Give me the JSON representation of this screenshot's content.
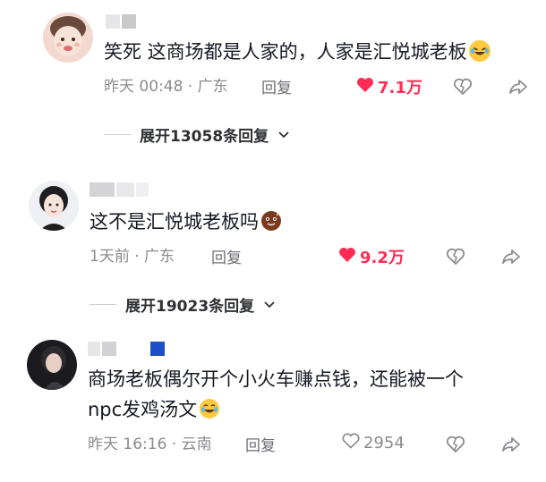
{
  "comments": [
    {
      "text": "笑死 这商场都是人家的，人家是汇悦城老板",
      "emoji": "rofl-emoji",
      "time_location": "昨天 00:48 · 广东",
      "reply_label": "回复",
      "likes": "7.1万",
      "liked": true,
      "expand_label": "展开13058条回复"
    },
    {
      "text": "这不是汇悦城老板吗",
      "emoji": "cookie-face-emoji",
      "time_location": "1天前 · 广东",
      "reply_label": "回复",
      "likes": "9.2万",
      "liked": true,
      "expand_label": "展开19023条回复"
    },
    {
      "text_line1": "商场老板偶尔开个小火车赚点钱，还能被一个",
      "text_line2": "npc发鸡汤文",
      "emoji": "tears-of-joy-emoji",
      "time_location": "昨天 16:16 · 云南",
      "reply_label": "回复",
      "likes": "2954",
      "liked": false
    }
  ],
  "colors": {
    "liked": "#fe2c55",
    "meta": "#8a8b91",
    "text": "#161823"
  },
  "icons": [
    "heart-icon",
    "dislike-heart-icon",
    "share-icon",
    "chevron-down-icon"
  ]
}
